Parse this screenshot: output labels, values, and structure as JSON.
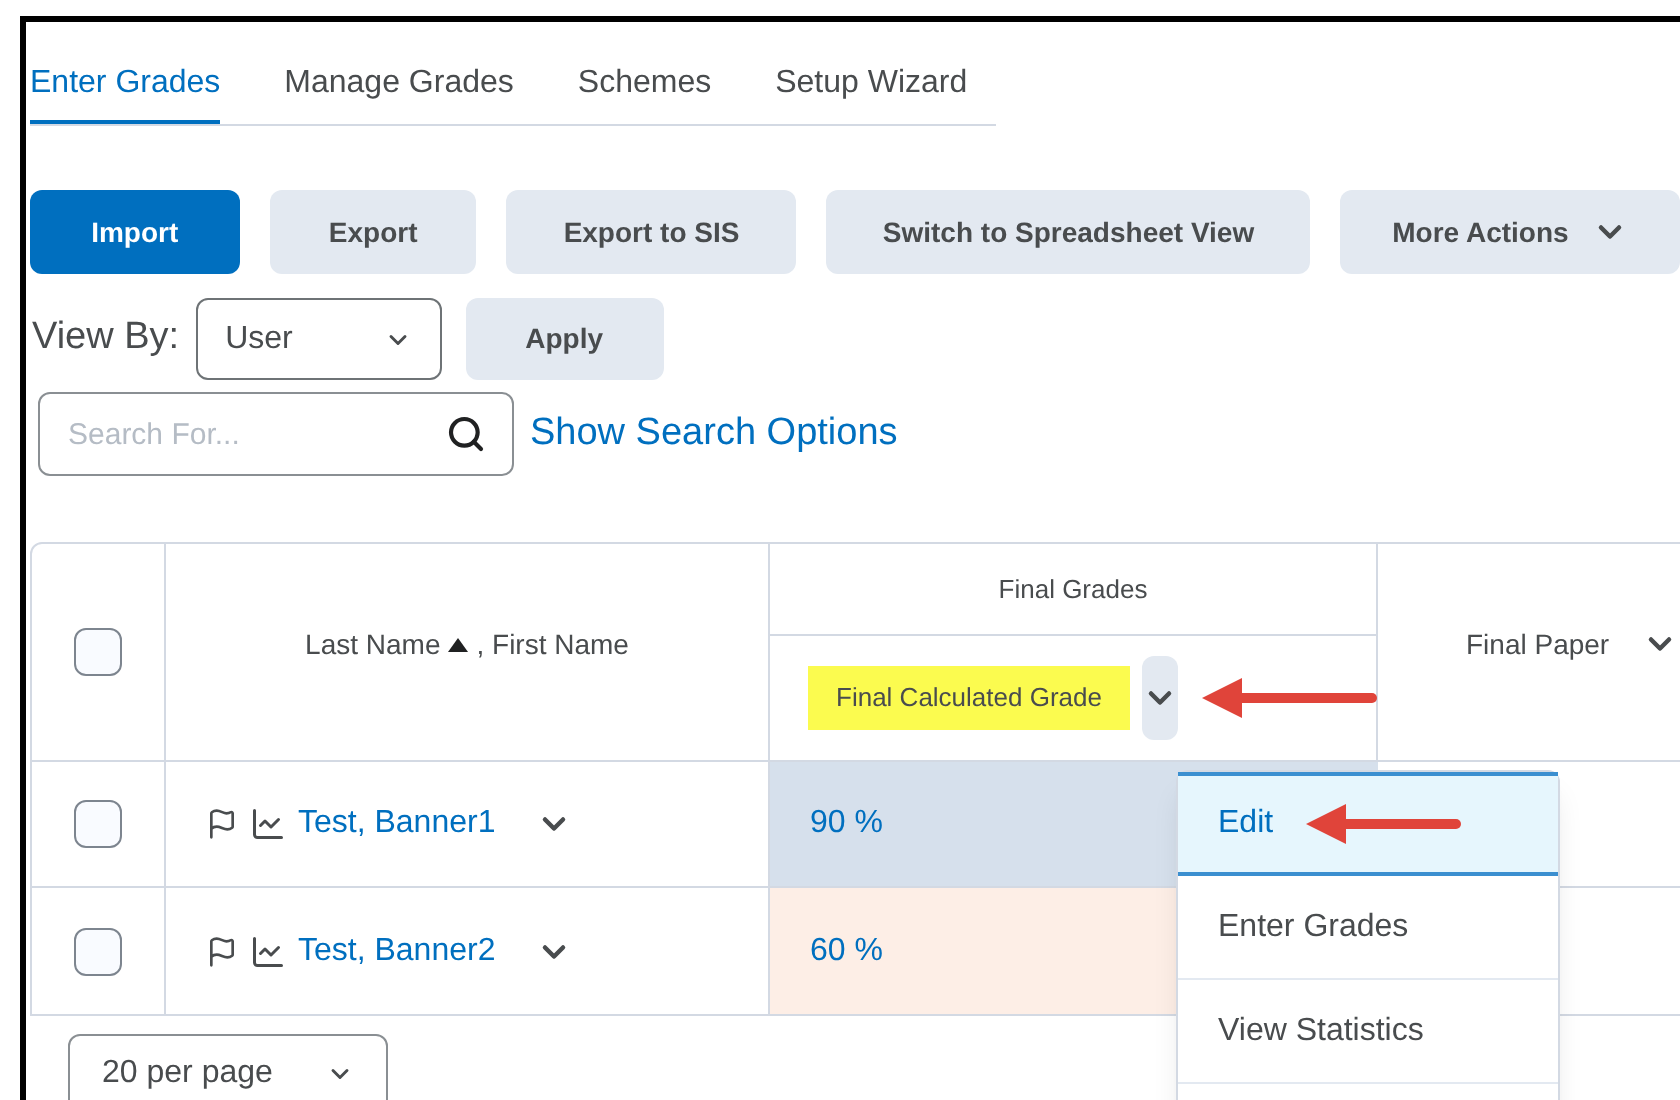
{
  "tabs": [
    {
      "label": "Enter Grades",
      "selected": true
    },
    {
      "label": "Manage Grades",
      "selected": false
    },
    {
      "label": "Schemes",
      "selected": false
    },
    {
      "label": "Setup Wizard",
      "selected": false
    }
  ],
  "actions": [
    {
      "label": "Import",
      "kind": "primary"
    },
    {
      "label": "Export",
      "kind": "secondary"
    },
    {
      "label": "Export to SIS",
      "kind": "secondary"
    },
    {
      "label": "Switch to Spreadsheet View",
      "kind": "secondary"
    },
    {
      "label": "More Actions",
      "kind": "menu"
    }
  ],
  "view_by": {
    "label": "View By:",
    "value": "User",
    "apply": "Apply"
  },
  "search": {
    "placeholder": "Search For...",
    "options_link": "Show Search Options"
  },
  "table": {
    "select_all_checked": false,
    "name_column": {
      "label": "Last Name",
      "suffix": ", First Name"
    },
    "group_column": {
      "label": "Final Grades",
      "sub_label": "Final Calculated Grade",
      "highlighted": true
    },
    "last_column": {
      "label": "Final Paper"
    },
    "rows": [
      {
        "name": "Test, Banner1",
        "grade": "90 %",
        "checked": false,
        "color": "#d6e0ec"
      },
      {
        "name": "Test, Banner2",
        "grade": "60 %",
        "checked": false,
        "color": "#fdeee6"
      }
    ]
  },
  "column_menu": [
    {
      "label": "Edit",
      "selected": true
    },
    {
      "label": "Enter Grades",
      "selected": false
    },
    {
      "label": "View Statistics",
      "selected": false
    }
  ],
  "pagination": {
    "value": "20 per page"
  }
}
